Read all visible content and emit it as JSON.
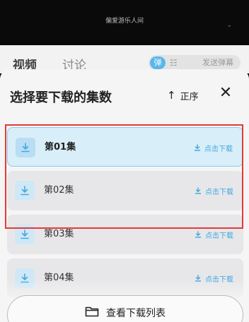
{
  "video": {
    "title": "偏爱游乐人间"
  },
  "background_tabs": {
    "video": "视频",
    "discuss": "讨论"
  },
  "danmu": {
    "toggle_label": "弹",
    "send_label": "发送弹幕"
  },
  "sheet": {
    "title": "选择要下载的集数",
    "sort_label": "正序",
    "close_label": "✕"
  },
  "episodes": [
    {
      "label": "第01集",
      "action": "点击下载",
      "selected": true
    },
    {
      "label": "第02集",
      "action": "点击下载",
      "selected": false
    },
    {
      "label": "第03集",
      "action": "点击下载",
      "selected": false
    },
    {
      "label": "第04集",
      "action": "点击下载",
      "selected": false
    }
  ],
  "footer": {
    "view_list_label": "查看下载列表"
  },
  "colors": {
    "accent": "#44a8de",
    "highlight": "#e53935",
    "selected_bg": "#d8eef9"
  }
}
